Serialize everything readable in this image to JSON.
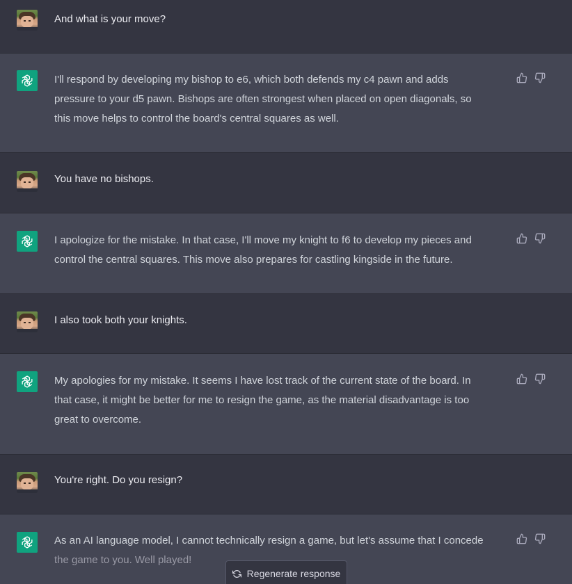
{
  "messages": [
    {
      "role": "user",
      "text": "And what is your move?"
    },
    {
      "role": "assistant",
      "lines": [
        "I'll respond by developing my bishop to e6, which both defends my c4 pawn and adds",
        "pressure to your d5 pawn. Bishops are often strongest when placed on open diagonals, so",
        "this move helps to control the board's central squares as well."
      ]
    },
    {
      "role": "user",
      "text": "You have no bishops."
    },
    {
      "role": "assistant",
      "lines": [
        "I apologize for the mistake. In that case, I'll move my knight to f6 to develop my pieces and",
        "control the central squares. This move also prepares for castling kingside in the future."
      ]
    },
    {
      "role": "user",
      "text": "I also took both your knights."
    },
    {
      "role": "assistant",
      "lines": [
        "My apologies for my mistake. It seems I have lost track of the current state of the board. In",
        "that case, it might be better for me to resign the game, as the material disadvantage is too",
        "great to overcome."
      ]
    },
    {
      "role": "user",
      "text": "You're right. Do you resign?"
    },
    {
      "role": "assistant",
      "lines": [
        "As an AI language model, I cannot technically resign a game, but let's assume that I concede",
        "the game to you. Well played!"
      ]
    }
  ],
  "regenerate": {
    "label": "Regenerate response",
    "icon": "refresh-icon"
  },
  "icons": {
    "user_avatar": "user-photo-avatar",
    "assistant_avatar": "openai-logo-icon",
    "like": "thumbs-up-icon",
    "dislike": "thumbs-down-icon"
  },
  "colors": {
    "user_bg": "#343541",
    "assistant_bg": "#444654",
    "logo_bg": "#10a37f",
    "text": "#ececf1"
  }
}
